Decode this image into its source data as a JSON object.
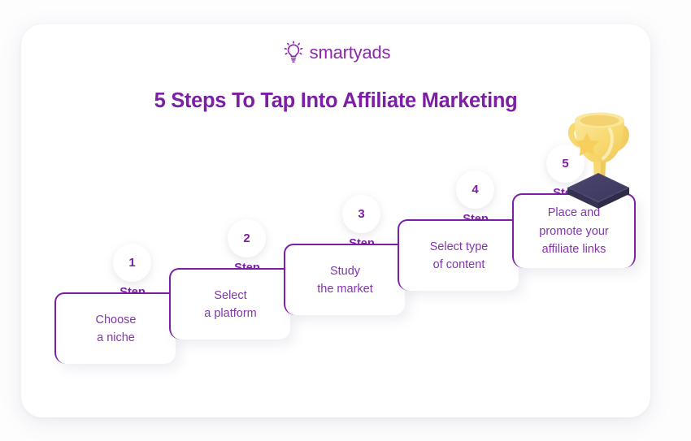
{
  "brand": {
    "logo_text": "smartyads",
    "logo_icon": "lightbulb-icon",
    "accent_purple": "#7d1fa5",
    "body_purple": "#8236ab",
    "trophy_gold": "#f8d96b",
    "trophy_base_navy": "#3e3a5f"
  },
  "header": {
    "title": "5 Steps To Tap Into Affiliate Marketing"
  },
  "steps": [
    {
      "number": "1",
      "label": "Step",
      "text": "Choose\na niche"
    },
    {
      "number": "2",
      "label": "Step",
      "text": "Select\na platform"
    },
    {
      "number": "3",
      "label": "Step",
      "text": "Study\nthe market"
    },
    {
      "number": "4",
      "label": "Step",
      "text": "Select type\nof content"
    },
    {
      "number": "5",
      "label": "Step",
      "text": "Place and\npromote your\naffiliate links"
    }
  ],
  "decor": {
    "trophy_icon": "trophy-icon"
  }
}
